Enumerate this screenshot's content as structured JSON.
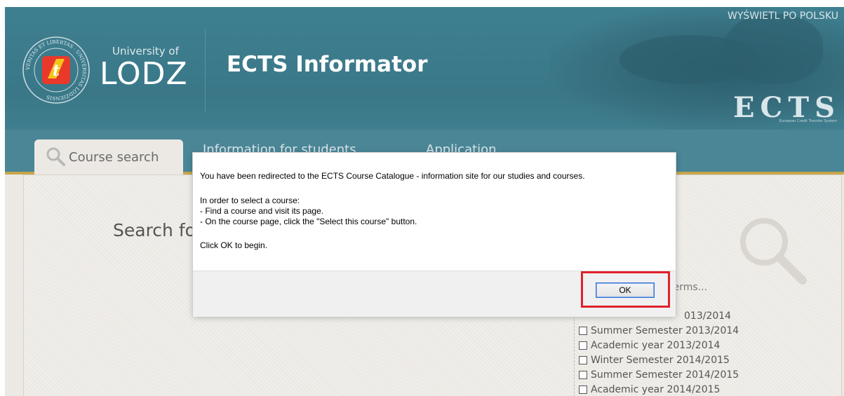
{
  "header": {
    "university_of": "University of",
    "university_name": "LODZ",
    "app_title": "ECTS Informator",
    "language_link": "WYŚWIETL PO POLSKU",
    "ects_logo": "ECTS",
    "ects_subtitle": "European Credit Transfer System",
    "seal_text": "VERITAS ET LIBERTAS · UNIVERSITAS LODZIENSIS"
  },
  "tabs": [
    {
      "label": "Course search",
      "icon": "magnifier-icon",
      "active": true
    },
    {
      "label": "Information for students",
      "icon": "info-icon",
      "active": false
    },
    {
      "label": "Application",
      "icon": "",
      "active": false
    }
  ],
  "main": {
    "search_heading": "Search fo",
    "terms_hint": "cted terms...",
    "terms": [
      "013/2014",
      "Summer Semester 2013/2014",
      "Academic year 2013/2014",
      "Winter Semester 2014/2015",
      "Summer Semester 2014/2015",
      "Academic year 2014/2015"
    ]
  },
  "dialog": {
    "line1": "You have been redirected to the ECTS Course Catalogue - information site for our studies and courses.",
    "line2": "In order to select a course:",
    "line3": "- Find a course and visit its page.",
    "line4": "- On the course page, click the \"Select this course\" button.",
    "line5": "Click OK to begin.",
    "ok_label": "OK"
  },
  "colors": {
    "header_bg": "#3e7f90",
    "tab_accent": "#c7a54a",
    "highlight_border": "#e0222b",
    "button_border": "#2f6fd0"
  }
}
